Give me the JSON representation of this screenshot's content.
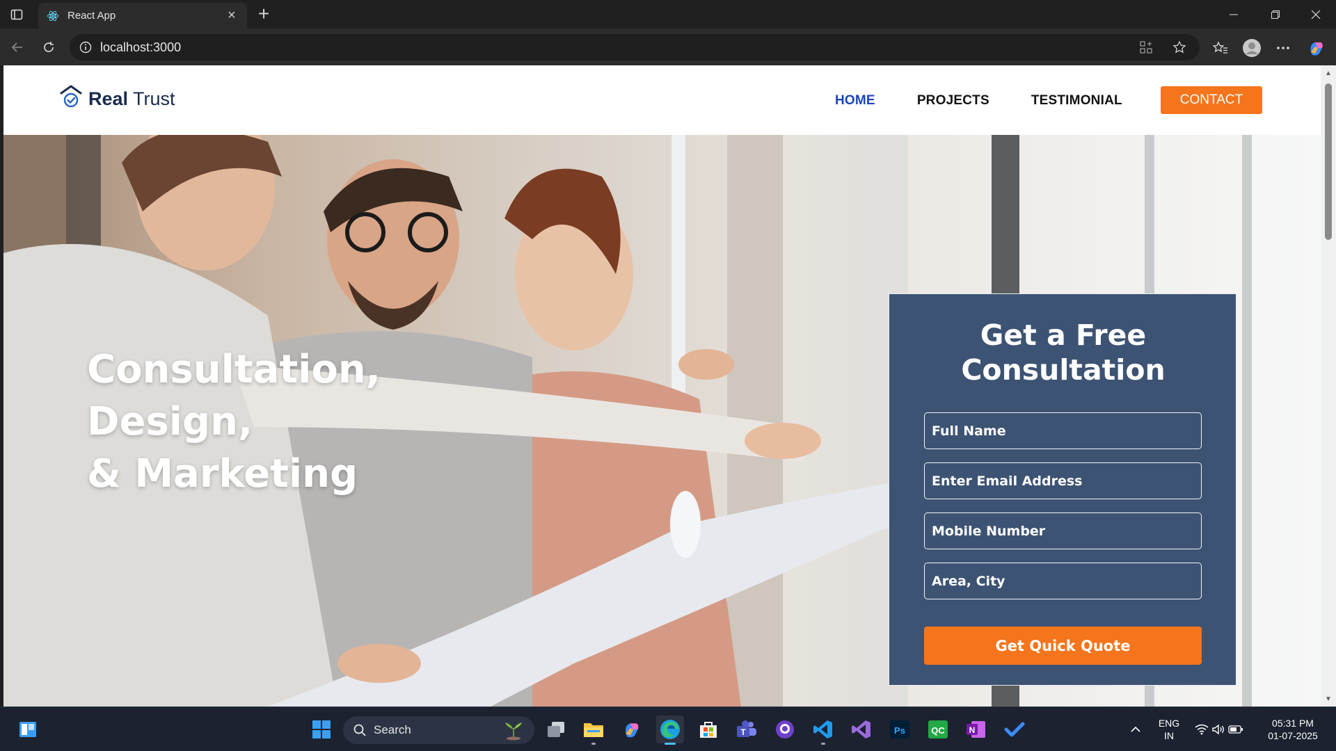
{
  "browser": {
    "tab_title": "React App",
    "tab_close": "×",
    "new_tab": "+",
    "url": "localhost:3000"
  },
  "site": {
    "logo": {
      "bold": "Real",
      "light": " Trust"
    },
    "nav": [
      {
        "label": "HOME",
        "active": true
      },
      {
        "label": "PROJECTS",
        "active": false
      },
      {
        "label": "TESTIMONIAL",
        "active": false
      }
    ],
    "contact_label": "CONTACT",
    "hero": {
      "line1": "Consultation,",
      "line2": "Design,",
      "line3": "& Marketing"
    },
    "form": {
      "title_line1": "Get a Free",
      "title_line2": "Consultation",
      "fields": {
        "name_placeholder": "Full Name",
        "email_placeholder": "Enter Email Address",
        "mobile_placeholder": "Mobile Number",
        "city_placeholder": "Area, City"
      },
      "submit_label": "Get Quick Quote"
    }
  },
  "taskbar": {
    "search_label": "Search",
    "language": "ENG",
    "region": "IN",
    "time": "05:31 PM",
    "date": "01-07-2025"
  },
  "colors": {
    "accent_orange": "#f5751c",
    "form_bg": "#3d5374",
    "nav_active": "#1e44b8"
  }
}
